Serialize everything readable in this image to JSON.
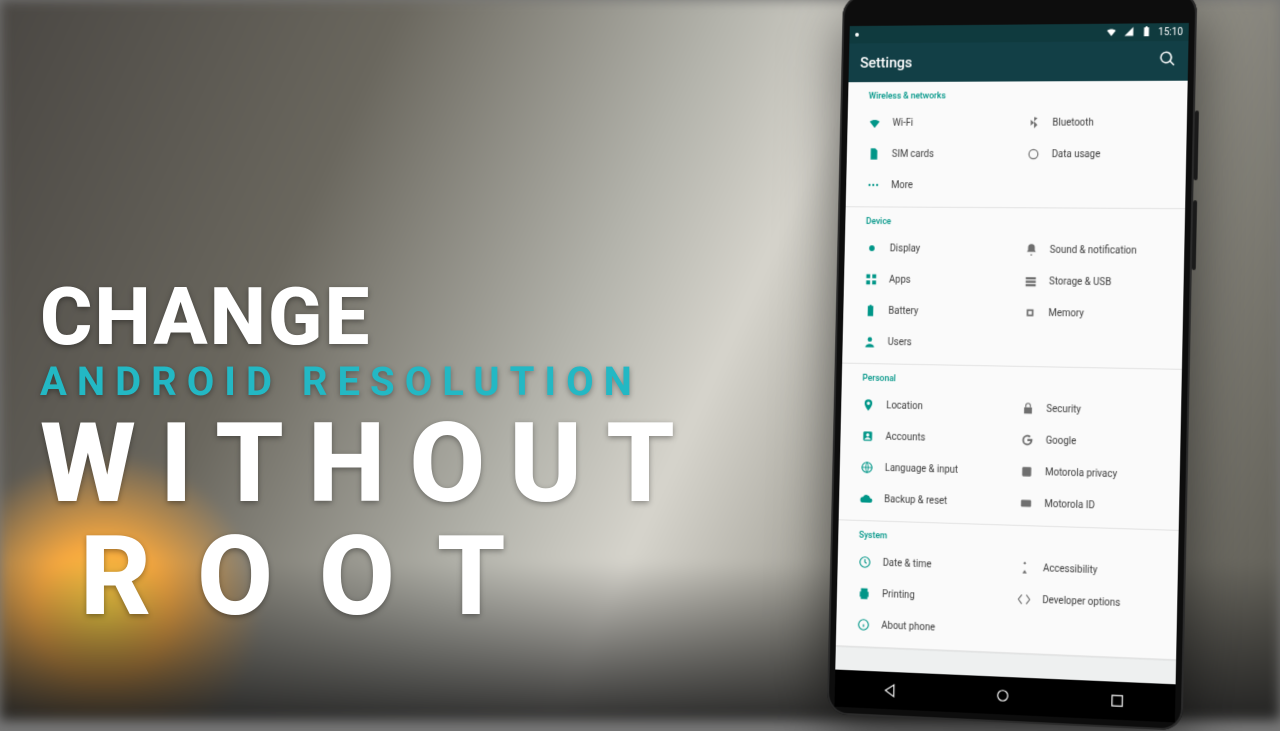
{
  "headline": {
    "l1": "CHANGE",
    "l2": "ANDROID RESOLUTION",
    "l3": "WITHOUT",
    "l4": "ROOT"
  },
  "statusbar": {
    "time": "15:10"
  },
  "appbar": {
    "title": "Settings"
  },
  "sections": {
    "wireless": {
      "header": "Wireless & networks",
      "wifi": "Wi-Fi",
      "bluetooth": "Bluetooth",
      "sim": "SIM cards",
      "datausage": "Data usage",
      "more": "More"
    },
    "device": {
      "header": "Device",
      "display": "Display",
      "sound": "Sound & notification",
      "apps": "Apps",
      "storage": "Storage & USB",
      "battery": "Battery",
      "memory": "Memory",
      "users": "Users"
    },
    "personal": {
      "header": "Personal",
      "location": "Location",
      "security": "Security",
      "accounts": "Accounts",
      "google": "Google",
      "language": "Language & input",
      "motoprivacy": "Motorola privacy",
      "backup": "Backup & reset",
      "motoid": "Motorola ID"
    },
    "system": {
      "header": "System",
      "datetime": "Date & time",
      "accessibility": "Accessibility",
      "printing": "Printing",
      "devopts": "Developer options",
      "about": "About phone"
    }
  }
}
